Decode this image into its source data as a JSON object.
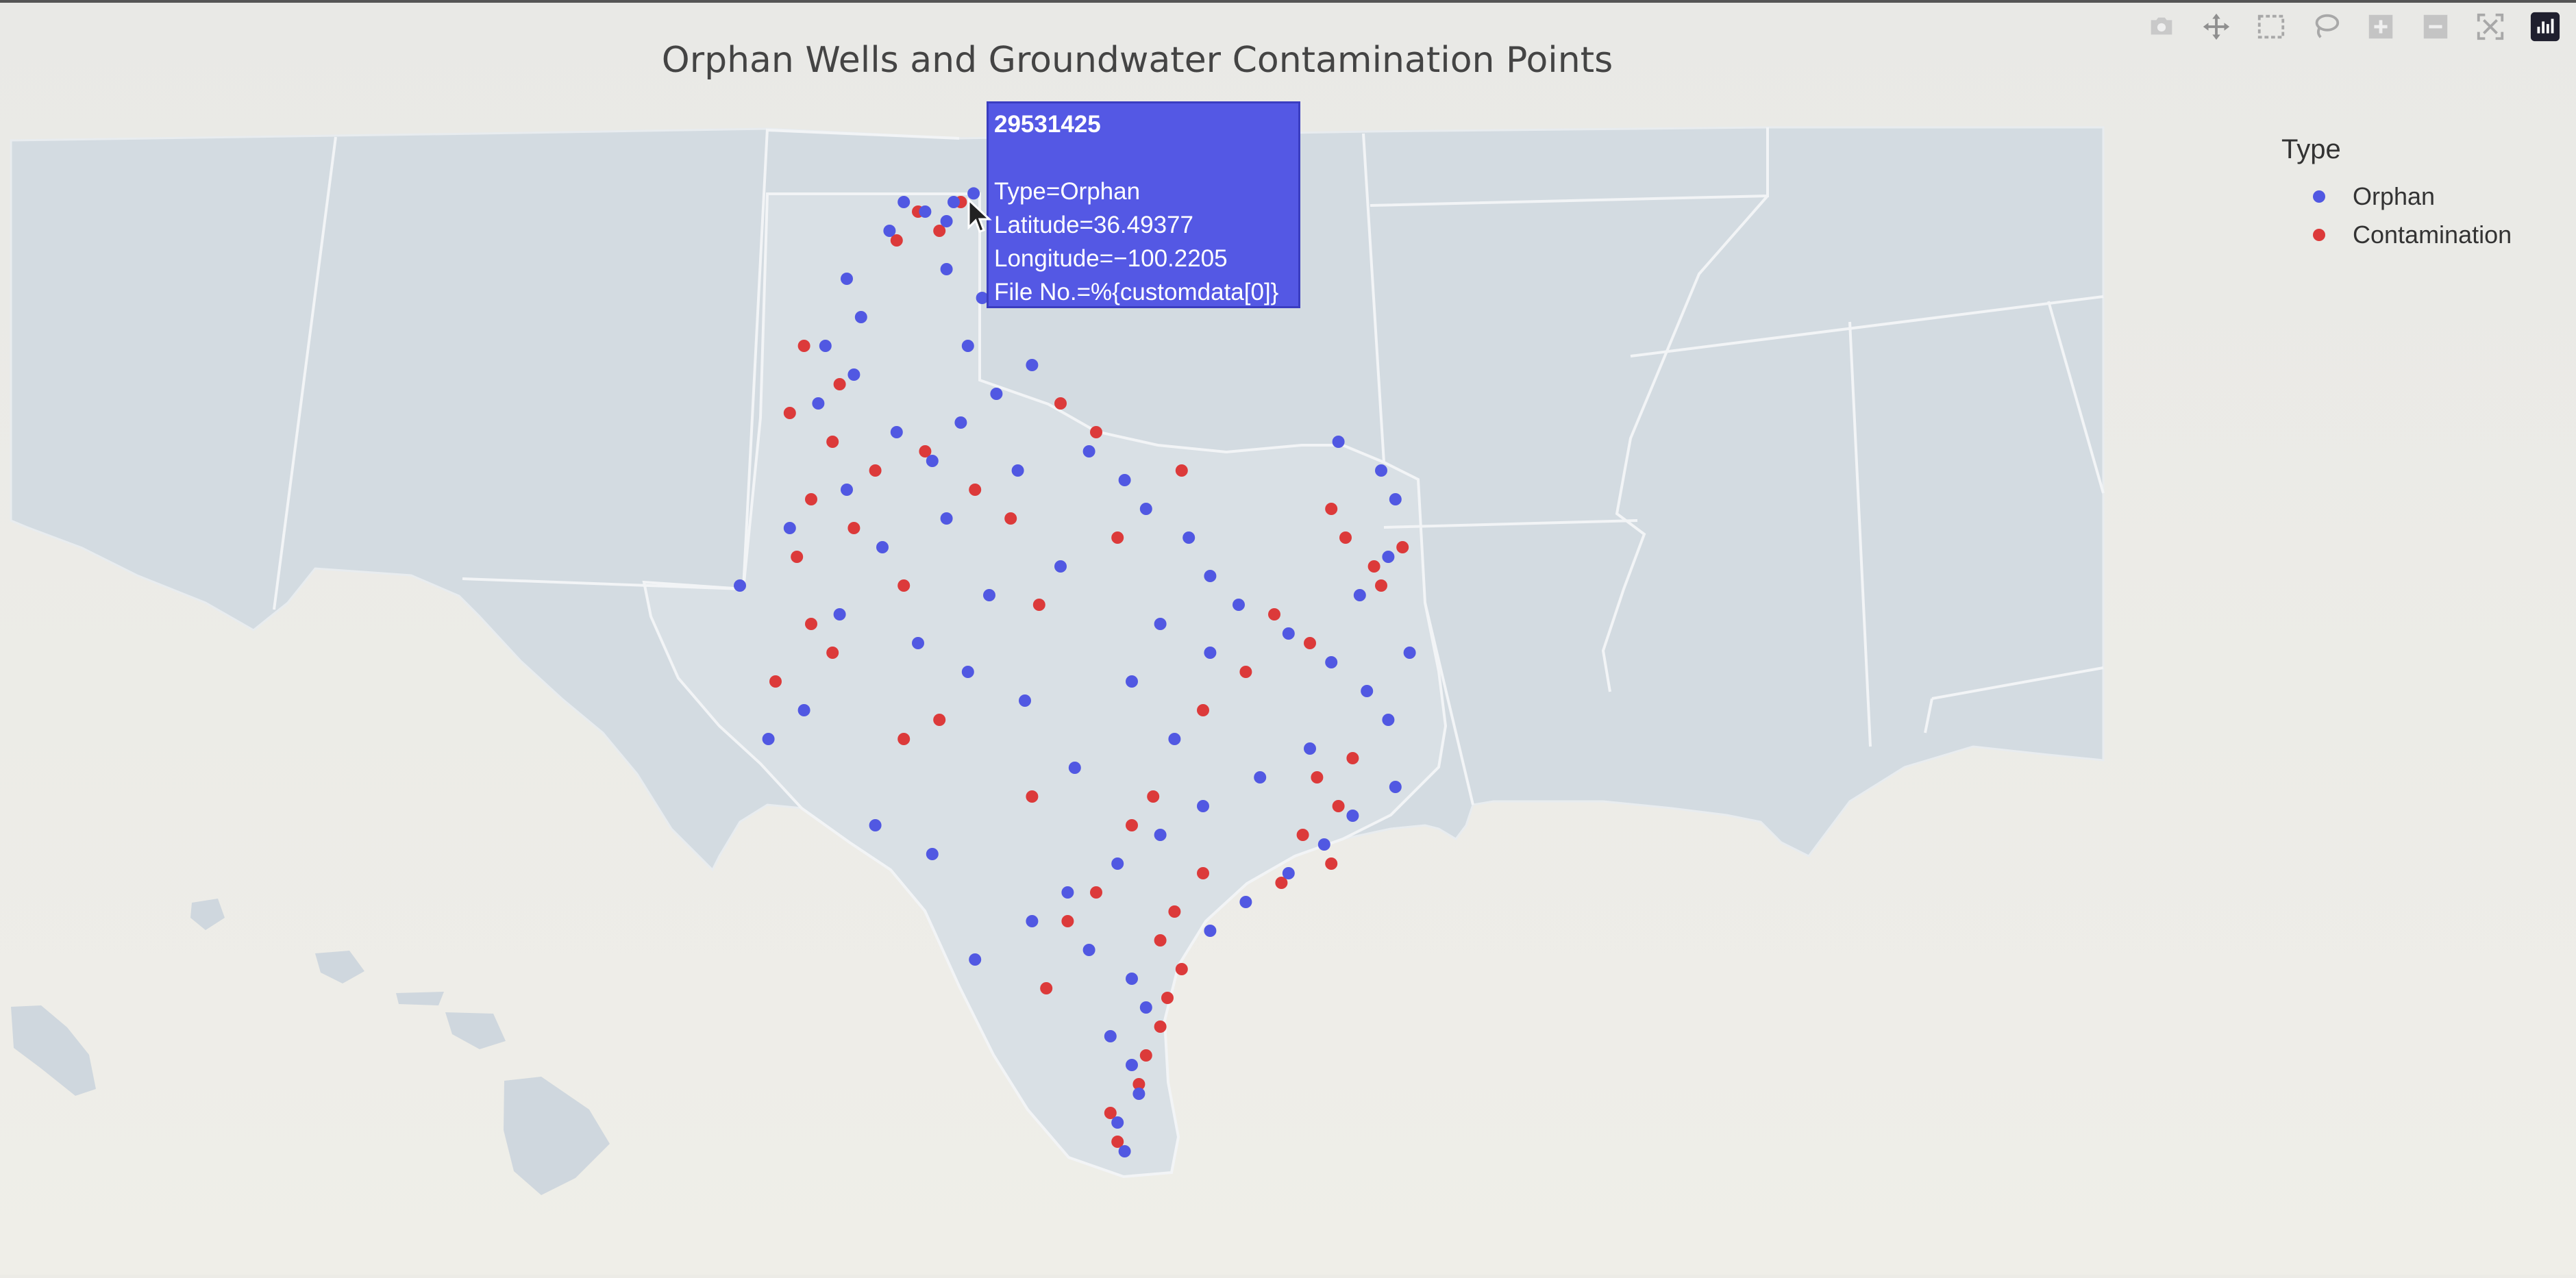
{
  "title": "Orphan Wells and Groundwater Contamination Points",
  "legend": {
    "title": "Type",
    "items": [
      {
        "label": "Orphan",
        "color": "#5158e2"
      },
      {
        "label": "Contamination",
        "color": "#dc3a3a"
      }
    ]
  },
  "hover": {
    "id": "29531425",
    "type_line": "Type=Orphan",
    "lat_line": "Latitude=36.49377",
    "lon_line": "Longitude=−100.2205",
    "file_line": "File No.=%{customdata[0]}"
  },
  "modebar": [
    "camera-icon",
    "pan-icon",
    "box-select-icon",
    "lasso-icon",
    "zoom-in-icon",
    "zoom-out-icon",
    "autoscale-icon",
    "plotly-logo-icon"
  ],
  "map": {
    "region": "Texas and surrounding states",
    "points": {
      "orphan": [
        [
          36.49,
          -100.22
        ],
        [
          36.4,
          -101.2
        ],
        [
          36.3,
          -100.9
        ],
        [
          36.2,
          -100.6
        ],
        [
          36.1,
          -101.4
        ],
        [
          36.4,
          -100.5
        ],
        [
          35.2,
          -101.8
        ],
        [
          34.9,
          -102.3
        ],
        [
          34.6,
          -101.9
        ],
        [
          34.3,
          -102.4
        ],
        [
          34.0,
          -101.3
        ],
        [
          33.7,
          -100.8
        ],
        [
          33.4,
          -102.0
        ],
        [
          33.0,
          -102.8
        ],
        [
          32.8,
          -101.5
        ],
        [
          32.4,
          -103.5
        ],
        [
          32.1,
          -102.1
        ],
        [
          31.8,
          -101.0
        ],
        [
          31.5,
          -100.3
        ],
        [
          31.2,
          -99.5
        ],
        [
          33.8,
          -98.6
        ],
        [
          33.5,
          -98.1
        ],
        [
          33.2,
          -97.8
        ],
        [
          32.9,
          -97.2
        ],
        [
          32.5,
          -96.9
        ],
        [
          32.2,
          -96.5
        ],
        [
          31.9,
          -95.8
        ],
        [
          31.6,
          -95.2
        ],
        [
          31.3,
          -94.7
        ],
        [
          31.0,
          -94.4
        ],
        [
          30.7,
          -95.5
        ],
        [
          30.4,
          -96.2
        ],
        [
          30.1,
          -97.0
        ],
        [
          29.8,
          -97.6
        ],
        [
          29.5,
          -98.2
        ],
        [
          29.2,
          -98.9
        ],
        [
          28.9,
          -99.4
        ],
        [
          28.6,
          -98.6
        ],
        [
          28.3,
          -98.0
        ],
        [
          28.0,
          -97.8
        ],
        [
          27.7,
          -98.3
        ],
        [
          27.4,
          -98.0
        ],
        [
          27.1,
          -97.9
        ],
        [
          26.8,
          -98.2
        ],
        [
          26.5,
          -98.1
        ],
        [
          33.9,
          -95.1
        ],
        [
          33.6,
          -94.5
        ],
        [
          33.3,
          -94.3
        ],
        [
          32.7,
          -94.4
        ],
        [
          32.3,
          -94.8
        ],
        [
          31.7,
          -94.1
        ],
        [
          30.3,
          -94.3
        ],
        [
          30.0,
          -94.9
        ],
        [
          29.7,
          -95.3
        ],
        [
          29.4,
          -95.8
        ],
        [
          29.1,
          -96.4
        ],
        [
          28.8,
          -96.9
        ],
        [
          35.7,
          -100.6
        ],
        [
          35.4,
          -100.1
        ],
        [
          34.7,
          -99.4
        ],
        [
          34.4,
          -99.9
        ],
        [
          34.1,
          -100.4
        ],
        [
          33.6,
          -99.6
        ],
        [
          32.6,
          -99.0
        ],
        [
          32.3,
          -100.0
        ],
        [
          31.4,
          -98.0
        ],
        [
          30.8,
          -97.4
        ],
        [
          30.5,
          -98.8
        ],
        [
          31.1,
          -102.6
        ],
        [
          30.8,
          -103.1
        ],
        [
          29.9,
          -101.6
        ],
        [
          29.6,
          -100.8
        ],
        [
          28.5,
          -100.2
        ],
        [
          33.1,
          -100.6
        ],
        [
          34.9,
          -100.3
        ],
        [
          35.6,
          -102.0
        ],
        [
          32.0,
          -97.6
        ],
        [
          31.7,
          -96.9
        ]
      ],
      "contamination": [
        [
          36.3,
          -101.0
        ],
        [
          36.1,
          -100.7
        ],
        [
          36.0,
          -101.3
        ],
        [
          36.4,
          -100.4
        ],
        [
          34.9,
          -102.6
        ],
        [
          34.5,
          -102.1
        ],
        [
          34.2,
          -102.8
        ],
        [
          33.9,
          -102.2
        ],
        [
          33.6,
          -101.6
        ],
        [
          33.3,
          -102.5
        ],
        [
          33.0,
          -101.9
        ],
        [
          32.7,
          -102.7
        ],
        [
          32.4,
          -101.2
        ],
        [
          32.0,
          -102.5
        ],
        [
          31.7,
          -102.2
        ],
        [
          31.4,
          -103.0
        ],
        [
          33.8,
          -100.9
        ],
        [
          33.4,
          -100.2
        ],
        [
          33.1,
          -99.7
        ],
        [
          34.3,
          -99.0
        ],
        [
          34.0,
          -98.5
        ],
        [
          35.8,
          -99.7
        ],
        [
          35.5,
          -99.3
        ],
        [
          35.9,
          -98.9
        ],
        [
          33.2,
          -95.2
        ],
        [
          32.9,
          -95.0
        ],
        [
          32.6,
          -94.6
        ],
        [
          32.8,
          -94.2
        ],
        [
          32.4,
          -94.5
        ],
        [
          30.4,
          -95.4
        ],
        [
          30.1,
          -95.1
        ],
        [
          29.8,
          -95.6
        ],
        [
          29.5,
          -95.2
        ],
        [
          29.3,
          -95.9
        ],
        [
          30.6,
          -94.9
        ],
        [
          29.0,
          -97.4
        ],
        [
          28.7,
          -97.6
        ],
        [
          28.4,
          -97.3
        ],
        [
          28.1,
          -97.5
        ],
        [
          27.8,
          -97.6
        ],
        [
          27.5,
          -97.8
        ],
        [
          27.2,
          -97.9
        ],
        [
          26.9,
          -98.3
        ],
        [
          26.6,
          -98.2
        ],
        [
          29.2,
          -98.5
        ],
        [
          29.9,
          -98.0
        ],
        [
          30.2,
          -97.7
        ],
        [
          31.1,
          -97.0
        ],
        [
          31.5,
          -96.4
        ],
        [
          31.8,
          -95.5
        ],
        [
          32.1,
          -96.0
        ],
        [
          28.9,
          -98.9
        ],
        [
          28.2,
          -99.2
        ],
        [
          30.8,
          -101.2
        ],
        [
          31.0,
          -100.7
        ],
        [
          30.2,
          -99.4
        ],
        [
          29.4,
          -97.0
        ],
        [
          32.2,
          -99.3
        ],
        [
          32.9,
          -98.2
        ],
        [
          33.6,
          -97.3
        ]
      ]
    }
  }
}
